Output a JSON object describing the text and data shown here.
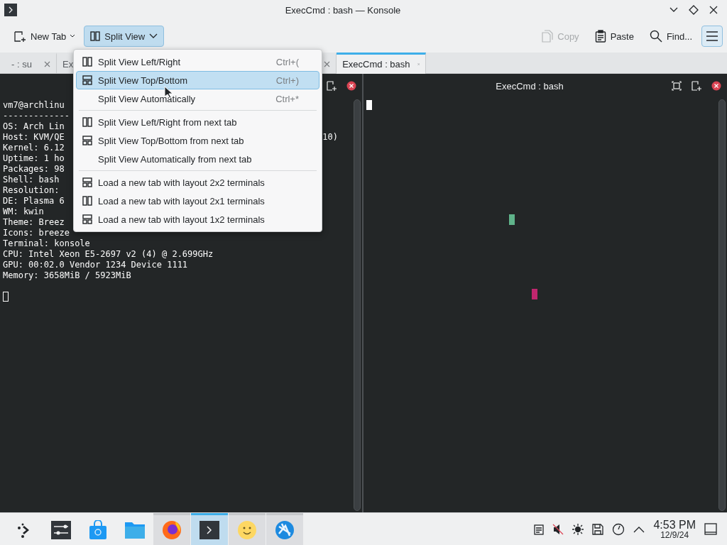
{
  "window": {
    "title": "ExecCmd : bash — Konsole"
  },
  "toolbar": {
    "left": [
      {
        "label": "New Tab",
        "kind": "newtab",
        "active": false
      },
      {
        "label": "Split View",
        "kind": "split",
        "active": true
      }
    ],
    "right": [
      {
        "label": "Copy",
        "kind": "copy",
        "disabled": true
      },
      {
        "label": "Paste",
        "kind": "paste",
        "disabled": false
      },
      {
        "label": "Find...",
        "kind": "find",
        "disabled": false
      }
    ]
  },
  "tabs": [
    {
      "label": "- : su",
      "selected": false,
      "close_button": true
    },
    {
      "label": "Ex",
      "selected": false,
      "close_button": false
    },
    {
      "selected": false,
      "close_button": true
    },
    {
      "label": "ExecCmd : bash",
      "selected": true,
      "close_button": true
    }
  ],
  "menu": {
    "items": [
      {
        "label": "Split View Left/Right",
        "shortcut": "Ctrl+(",
        "kind": "columns",
        "selected": false
      },
      {
        "label": "Split View Top/Bottom",
        "shortcut": "Ctrl+)",
        "kind": "rows",
        "selected": true
      },
      {
        "label": "Split View Automatically",
        "shortcut": "Ctrl+*",
        "selected": false,
        "separator_after": true
      },
      {
        "label": "Split View Left/Right from next tab",
        "kind": "columns",
        "selected": false
      },
      {
        "label": "Split View Top/Bottom from next tab",
        "kind": "rows",
        "selected": false
      },
      {
        "label": "Split View Automatically from next tab",
        "selected": false,
        "separator_after": true
      },
      {
        "label": "Load a new tab with layout 2x2 terminals",
        "kind": "rows",
        "selected": false
      },
      {
        "label": "Load a new tab with layout 2x1 terminals",
        "kind": "columns",
        "selected": false
      },
      {
        "label": "Load a new tab with layout 1x2 terminals",
        "kind": "rows",
        "selected": false
      }
    ]
  },
  "left_pane": {
    "lines": [
      {
        "text": "vm7@archlinu"
      },
      {
        "text": "-------------"
      },
      {
        "text": "OS: Arch Lin"
      },
      {
        "text": "Host: KVM/QE",
        "tail": "10)"
      },
      {
        "text": "Kernel: 6.12"
      },
      {
        "text": "Uptime: 1 ho"
      },
      {
        "text": "Packages: 98"
      },
      {
        "text": "Shell: bash"
      },
      {
        "text": "Resolution:"
      },
      {
        "text": "DE: Plasma 6"
      },
      {
        "text": "WM: kwin"
      },
      {
        "text": "Theme: Breez"
      },
      {
        "text": "Icons: breeze"
      },
      {
        "text": "Terminal: konsole"
      },
      {
        "text": "CPU: Intel Xeon E5-2697 v2 (4) @ 2.699GHz"
      },
      {
        "text": "GPU: 00:02.0 Vendor 1234 Device 1111"
      },
      {
        "text": "Memory: 3658MiB / 5923MiB"
      }
    ]
  },
  "right_pane": {
    "title": "ExecCmd : bash",
    "blocks": [
      {
        "color": "#5fb38a"
      },
      {
        "color": "#c0266e"
      }
    ]
  },
  "taskbar": {
    "apps": [
      {
        "kind": "launcher",
        "selected": false,
        "running": false
      },
      {
        "kind": "settings",
        "selected": false,
        "running": false
      },
      {
        "kind": "store",
        "selected": false,
        "running": false
      },
      {
        "kind": "folder",
        "selected": false,
        "running": false
      },
      {
        "kind": "browser",
        "selected": false,
        "running": true
      },
      {
        "kind": "terminal",
        "selected": true,
        "running": true
      },
      {
        "kind": "smiley",
        "selected": false,
        "running": true
      },
      {
        "kind": "globe",
        "selected": false,
        "running": true
      }
    ],
    "tray": [
      {
        "kind": "clipboard"
      },
      {
        "kind": "mute"
      },
      {
        "kind": "brightness"
      },
      {
        "kind": "disk"
      },
      {
        "kind": "gauge"
      },
      {
        "kind": "expand"
      }
    ],
    "time": "4:53 PM",
    "date": "12/9/24"
  }
}
